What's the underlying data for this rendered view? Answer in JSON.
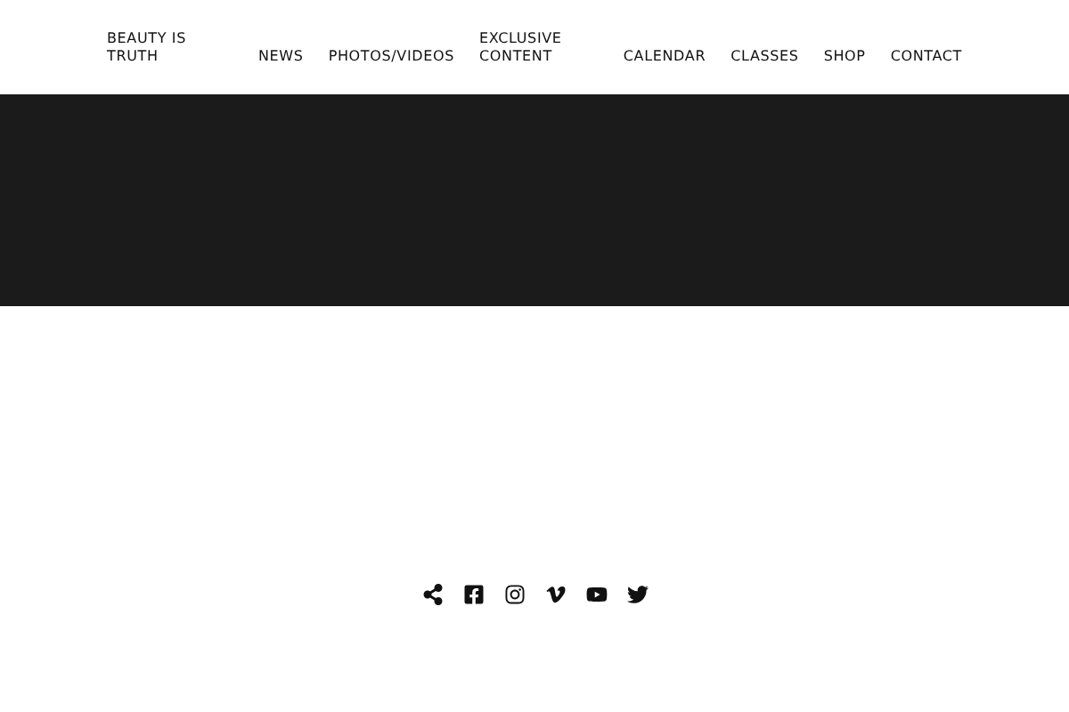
{
  "header": {
    "brand": "BEAUTY IS TRUTH",
    "nav_left": [
      "NEWS",
      "PHOTOS/VIDEOS",
      "EXCLUSIVE CONTENT"
    ],
    "nav_right": [
      "CALENDAR",
      "CLASSES",
      "SHOP",
      "CONTACT"
    ]
  },
  "social_links": [
    {
      "kind": "share"
    },
    {
      "kind": "facebook"
    },
    {
      "kind": "instagram"
    },
    {
      "kind": "vimeo"
    },
    {
      "kind": "youtube"
    },
    {
      "kind": "twitter"
    }
  ]
}
